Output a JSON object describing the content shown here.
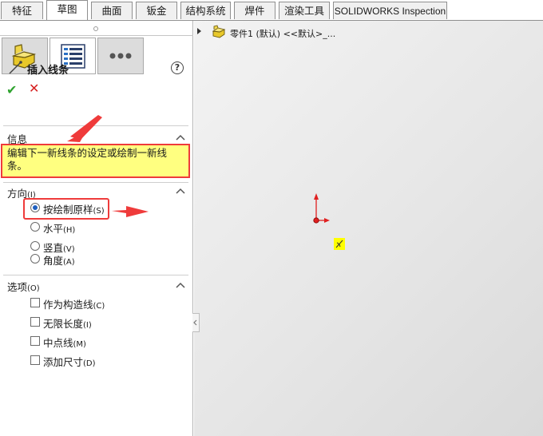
{
  "tabs": [
    {
      "label": "特征"
    },
    {
      "label": "草图"
    },
    {
      "label": "曲面"
    },
    {
      "label": "钣金"
    },
    {
      "label": "结构系统"
    },
    {
      "label": "焊件"
    },
    {
      "label": "渲染工具"
    },
    {
      "label": "SOLIDWORKS Inspection"
    }
  ],
  "active_tab": "草图",
  "panel": {
    "tab_icons": [
      "feature-manager-icon",
      "property-manager-icon",
      "more-icon"
    ],
    "title": "插入线条",
    "help_symbol": "?",
    "ok_symbol": "✔",
    "cancel_symbol": "✕",
    "info": {
      "heading": "信息",
      "message": "编辑下一新线条的设定或绘制一新线条。"
    },
    "orientation": {
      "heading": "方向",
      "heading_key": "(I)",
      "options": [
        {
          "label": "按绘制原样",
          "key": "(S)",
          "selected": true
        },
        {
          "label": "水平",
          "key": "(H)",
          "selected": false
        },
        {
          "label": "竖直",
          "key": "(V)",
          "selected": false
        },
        {
          "label": "角度",
          "key": "(A)",
          "selected": false
        }
      ]
    },
    "options": {
      "heading": "选项",
      "heading_key": "(O)",
      "items": [
        {
          "label": "作为构造线",
          "key": "(C)",
          "checked": false
        },
        {
          "label": "无限长度",
          "key": "(I)",
          "checked": false
        },
        {
          "label": "中点线",
          "key": "(M)",
          "checked": false
        },
        {
          "label": "添加尺寸",
          "key": "(D)",
          "checked": false
        }
      ]
    }
  },
  "graphics": {
    "tree_item": "零件1 (默认) <<默认>_..."
  },
  "colors": {
    "highlight_red": "#ef3b3b",
    "info_yellow": "#ffff80",
    "ok_green": "#2fa32f",
    "cancel_red": "#d62020",
    "radio_blue": "#1e5fbf"
  }
}
